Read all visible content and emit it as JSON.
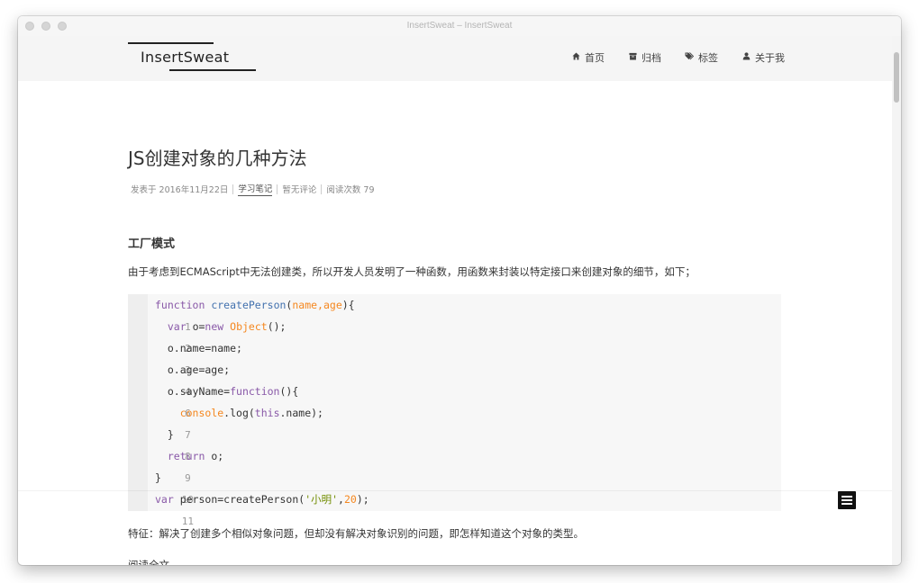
{
  "window": {
    "title": "InsertSweat – InsertSweat"
  },
  "header": {
    "logo": "InsertSweat",
    "nav": [
      {
        "icon": "home-icon",
        "label": "首页"
      },
      {
        "icon": "archive-icon",
        "label": "归档"
      },
      {
        "icon": "tags-icon",
        "label": "标签"
      },
      {
        "icon": "user-icon",
        "label": "关于我"
      }
    ]
  },
  "post": {
    "title": "JS创建对象的几种方法",
    "meta": {
      "date": "发表于 2016年11月22日",
      "category": "学习笔记",
      "comments": "暂无评论",
      "views": "阅读次数 79"
    },
    "section_title": "工厂模式",
    "intro": "由于考虑到ECMAScript中无法创建类，所以开发人员发明了一种函数，用函数来封装以特定接口来创建对象的细节，如下；",
    "code_line_numbers": [
      "1",
      "2",
      "3",
      "4",
      "5",
      "6",
      "7",
      "8",
      "9",
      "10",
      "11"
    ],
    "code": [
      "function createPerson(name,age){",
      "  var o=new Object();",
      "  o.name=name;",
      "  o.age=age;",
      "  o.sayName=function(){",
      "    console.log(this.name);",
      "  }",
      "  return o;",
      "}",
      "var person=createPerson('小明',20);"
    ],
    "feature": "特征：解决了创建多个相似对象问题，但却没有解决对象识别的问题，即怎样知道这个对象的类型。",
    "read_more": "阅读全文"
  },
  "colors": {
    "keyword": "#8959a8",
    "function_name": "#4271ae",
    "param": "#f5871f",
    "string": "#718c00",
    "header_bg": "#f5f5f5",
    "code_bg": "#f7f7f7"
  }
}
